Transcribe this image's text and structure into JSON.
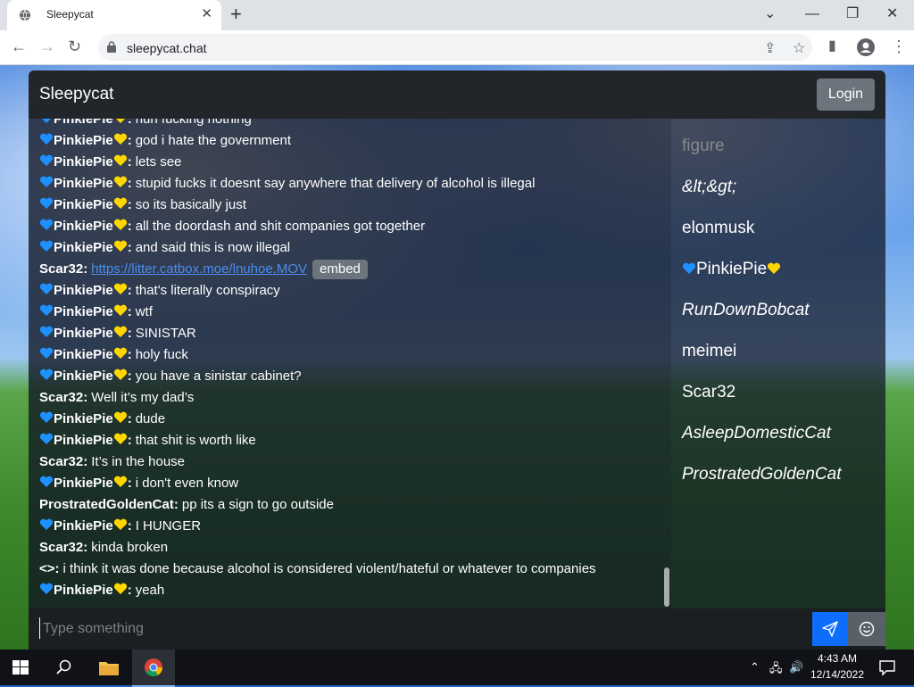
{
  "browser": {
    "tab_title": "Sleepycat",
    "url": "sleepycat.chat"
  },
  "app": {
    "title": "Sleepycat",
    "login_label": "Login",
    "input_placeholder": "Type something",
    "embed_label": "embed"
  },
  "messages": [
    {
      "heart": true,
      "user": "PinkiePie",
      "sep": ":",
      "text": "nun fucking nothing"
    },
    {
      "heart": true,
      "user": "PinkiePie",
      "sep": ":",
      "text": "god i hate the government"
    },
    {
      "heart": true,
      "user": "PinkiePie",
      "sep": ":",
      "text": "lets see"
    },
    {
      "heart": true,
      "user": "PinkiePie",
      "sep": ":",
      "text": "stupid fucks it doesnt say anywhere that delivery of alcohol is illegal"
    },
    {
      "heart": true,
      "user": "PinkiePie",
      "sep": ":",
      "text": "so its basically just"
    },
    {
      "heart": true,
      "user": "PinkiePie",
      "sep": ":",
      "text": "all the doordash and shit companies got together"
    },
    {
      "heart": true,
      "user": "PinkiePie",
      "sep": ":",
      "text": "and said this is now illegal"
    },
    {
      "heart": false,
      "user": "Scar32",
      "sep": ":",
      "text": "",
      "link": "https://litter.catbox.moe/lnuhoe.MOV"
    },
    {
      "heart": true,
      "user": "PinkiePie",
      "sep": ":",
      "text": "that's literally conspiracy"
    },
    {
      "heart": true,
      "user": "PinkiePie",
      "sep": ":",
      "text": "wtf"
    },
    {
      "heart": true,
      "user": "PinkiePie",
      "sep": ":",
      "text": "SINISTAR"
    },
    {
      "heart": true,
      "user": "PinkiePie",
      "sep": ":",
      "text": "holy fuck"
    },
    {
      "heart": true,
      "user": "PinkiePie",
      "sep": ":",
      "text": "you have a sinistar cabinet?"
    },
    {
      "heart": false,
      "user": "Scar32",
      "sep": ":",
      "text": "Well it’s my dad’s"
    },
    {
      "heart": true,
      "user": "PinkiePie",
      "sep": ":",
      "text": "dude"
    },
    {
      "heart": true,
      "user": "PinkiePie",
      "sep": ":",
      "text": "that shit is worth like"
    },
    {
      "heart": false,
      "user": "Scar32",
      "sep": ":",
      "text": "It’s in the house"
    },
    {
      "heart": true,
      "user": "PinkiePie",
      "sep": ":",
      "text": "i don't even know"
    },
    {
      "heart": false,
      "user": "ProstratedGoldenCat",
      "sep": ":",
      "text": "pp its a sign to go outside"
    },
    {
      "heart": true,
      "user": "PinkiePie",
      "sep": ":",
      "text": "I HUNGER"
    },
    {
      "heart": false,
      "user": "Scar32",
      "sep": ":",
      "text": "kinda broken"
    },
    {
      "heart": false,
      "user": "<>",
      "sep": ":",
      "text": "i think it was done because alcohol is considered violent/hateful or whatever to companies"
    },
    {
      "heart": true,
      "user": "PinkiePie",
      "sep": ":",
      "text": "yeah"
    }
  ],
  "users": [
    {
      "name": "figure",
      "italic": false,
      "faded": true,
      "hearts": false
    },
    {
      "name": "&lt;&gt;",
      "italic": true,
      "faded": false,
      "hearts": false
    },
    {
      "name": "elonmusk",
      "italic": false,
      "faded": false,
      "hearts": false
    },
    {
      "name": "PinkiePie",
      "italic": false,
      "faded": false,
      "hearts": true
    },
    {
      "name": "RunDownBobcat",
      "italic": true,
      "faded": false,
      "hearts": false
    },
    {
      "name": "meimei",
      "italic": false,
      "faded": false,
      "hearts": false
    },
    {
      "name": "Scar32",
      "italic": false,
      "faded": false,
      "hearts": false
    },
    {
      "name": "AsleepDomesticCat",
      "italic": true,
      "faded": false,
      "hearts": false
    },
    {
      "name": "ProstratedGoldenCat",
      "italic": true,
      "faded": false,
      "hearts": false
    }
  ],
  "taskbar": {
    "time": "4:43 AM",
    "date": "12/14/2022"
  },
  "colors": {
    "blue_heart": "#1e90ff",
    "yellow_heart": "#ffd700",
    "send_button": "#0d6efd"
  }
}
